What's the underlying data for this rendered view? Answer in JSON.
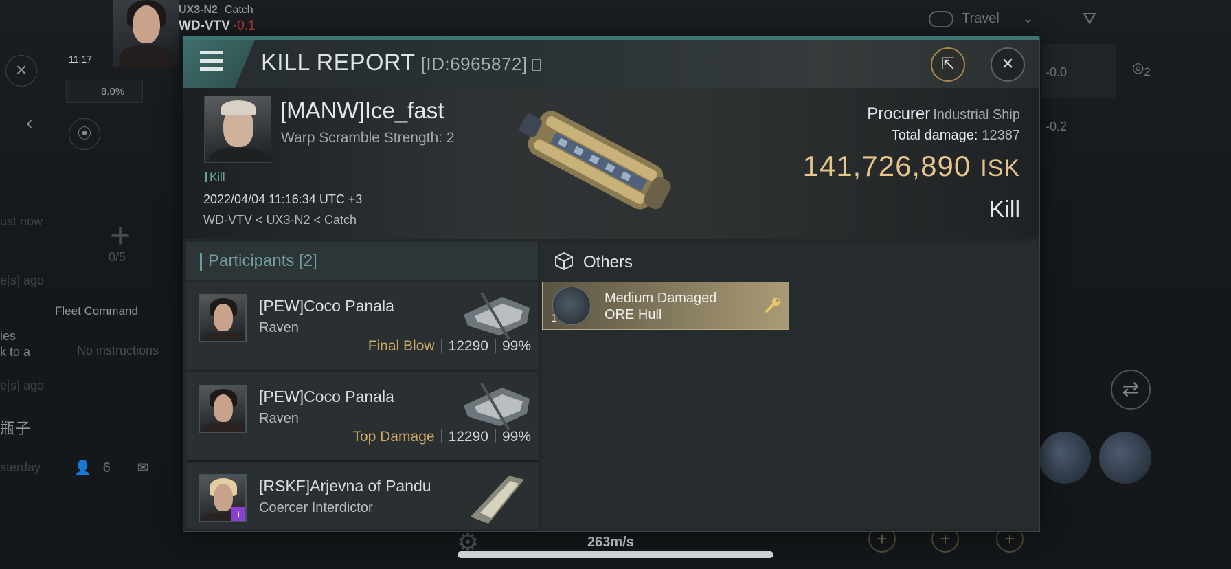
{
  "hud": {
    "location_system": "UX3-N2",
    "location_sub": "Catch",
    "location_current": "WD-VTV",
    "location_sec": "-0.1",
    "time": "11:17",
    "cargo_percent": "8.0%",
    "fleet_count": "0/5",
    "fleet_command": "Fleet Command",
    "no_instructions": "No instructions",
    "chat_just_now": "ust now",
    "chat_ago_1": "e[s] ago",
    "chat_ago_2": "e[s] ago",
    "chat_yesterday": "sterday",
    "chat_snippet": "ies\nk to a",
    "chat_cjk": "瓶子",
    "member_count": "6",
    "travel_label": "Travel",
    "right_value_1": "-0.0",
    "right_value_2": "-0.2",
    "right_count": "2",
    "speed": "263m/s"
  },
  "report": {
    "title": "KILL REPORT",
    "id_label": "[ID:6965872]",
    "victim": {
      "name": "[MANW]Ice_fast",
      "warp_scramble": "Warp Scramble Strength: 2",
      "kill_tag": "Kill",
      "datetime": "2022/04/04 11:16:34 UTC +3",
      "location": "WD-VTV < UX3-N2 < Catch"
    },
    "ship": {
      "name": "Procurer",
      "class": "Industrial Ship",
      "total_damage_label": "Total damage:",
      "total_damage": "12387",
      "isk_value": "141,726,890",
      "isk_unit": "ISK",
      "result": "Kill"
    },
    "participants": {
      "header": "Participants [2]",
      "rows": [
        {
          "name": "[PEW]Coco Panala",
          "ship": "Raven",
          "role": "Final Blow",
          "damage": "12290",
          "percent": "99%"
        },
        {
          "name": "[PEW]Coco Panala",
          "ship": "Raven",
          "role": "Top Damage",
          "damage": "12290",
          "percent": "99%"
        },
        {
          "name": "[RSKF]Arjevna of Pandu",
          "ship": "Coercer Interdictor",
          "role": "",
          "damage": "",
          "percent": ""
        }
      ]
    },
    "others": {
      "header": "Others",
      "items": [
        {
          "name_line1": "Medium Damaged",
          "name_line2": "ORE Hull",
          "quantity": "1"
        }
      ]
    }
  },
  "colors": {
    "accent_teal": "#3b7470",
    "isk_gold": "#e6c58d",
    "role_gold": "#cfa864",
    "item_card": "#a99b75"
  }
}
